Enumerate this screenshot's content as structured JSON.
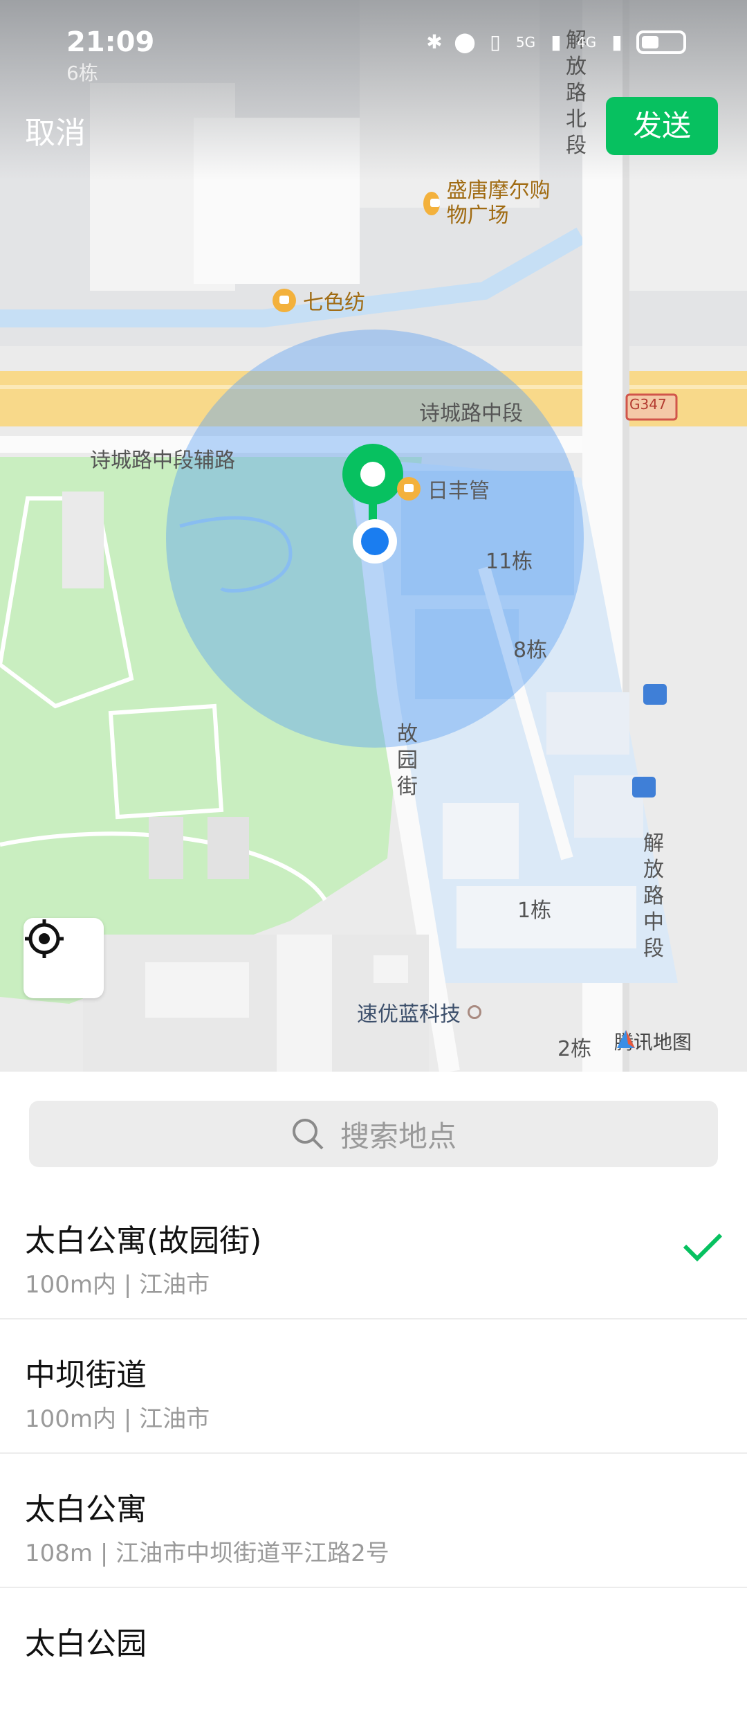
{
  "status_bar": {
    "time": "21:09",
    "under_time": "6栋",
    "signal_1": "5G",
    "signal_2": "4G"
  },
  "header": {
    "cancel_label": "取消",
    "send_label": "发送"
  },
  "map": {
    "roads": {
      "road_main": "诗城路中段",
      "road_aux": "诗城路中段辅路",
      "road_east_north": "解放路北段",
      "road_east_mid": "解放路中段",
      "road_lane": "故园街",
      "highway_badge": "G347"
    },
    "pois": {
      "mall": "盛唐摩尔购物广场",
      "shop_1": "七色纺",
      "shop_2": "日丰管",
      "company": "速优蓝科技"
    },
    "buildings": {
      "b11": "11栋",
      "b8": "8栋",
      "b1": "1栋",
      "b2": "2栋"
    },
    "brand": "腾讯地图",
    "colors": {
      "park": "#c9eec0",
      "water": "#b8d7f3",
      "road_yellow": "#f7d888",
      "accuracy_circle": "#5b9ff2",
      "marker": "#07c160",
      "user_dot": "#1a7df0"
    }
  },
  "search": {
    "placeholder": "搜索地点",
    "icon": "search-icon"
  },
  "results": [
    {
      "title": "太白公寓(故园街)",
      "subtitle": "100m内 | 江油市",
      "selected": true
    },
    {
      "title": "中坝街道",
      "subtitle": "100m内 | 江油市",
      "selected": false
    },
    {
      "title": "太白公寓",
      "subtitle": "108m | 江油市中坝街道平江路2号",
      "selected": false
    },
    {
      "title": "太白公园",
      "subtitle": "",
      "selected": false
    }
  ]
}
